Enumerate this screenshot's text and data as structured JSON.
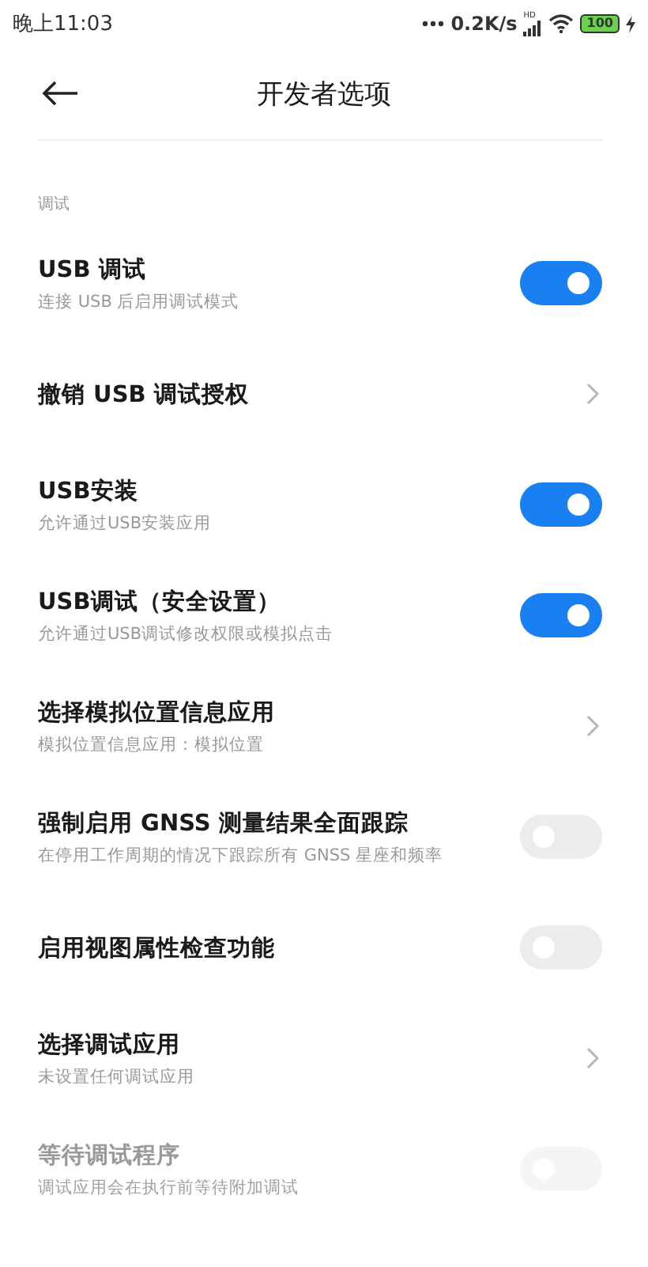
{
  "status_bar": {
    "time": "晚上11:03",
    "speed": "0.2K/s",
    "network": "HD",
    "battery": "100"
  },
  "header": {
    "title": "开发者选项"
  },
  "section": {
    "label": "调试"
  },
  "rows": [
    {
      "kind": "switch",
      "title": "USB 调试",
      "subtitle": "连接 USB 后启用调试模式",
      "on": true,
      "disabled": false
    },
    {
      "kind": "link",
      "title": "撤销 USB 调试授权",
      "disabled": false
    },
    {
      "kind": "switch",
      "title": "USB安装",
      "subtitle": "允许通过USB安装应用",
      "on": true,
      "disabled": false
    },
    {
      "kind": "switch",
      "title": "USB调试（安全设置）",
      "subtitle": "允许通过USB调试修改权限或模拟点击",
      "on": true,
      "disabled": false
    },
    {
      "kind": "link",
      "title": "选择模拟位置信息应用",
      "subtitle": "模拟位置信息应用：模拟位置",
      "disabled": false
    },
    {
      "kind": "switch",
      "title": "强制启用 GNSS 测量结果全面跟踪",
      "subtitle": "在停用工作周期的情况下跟踪所有 GNSS 星座和频率",
      "on": false,
      "disabled": false
    },
    {
      "kind": "switch",
      "title": "启用视图属性检查功能",
      "on": false,
      "disabled": false
    },
    {
      "kind": "link",
      "title": "选择调试应用",
      "subtitle": "未设置任何调试应用",
      "disabled": false
    },
    {
      "kind": "switch",
      "title": "等待调试程序",
      "subtitle": "调试应用会在执行前等待附加调试",
      "on": false,
      "disabled": true
    }
  ]
}
